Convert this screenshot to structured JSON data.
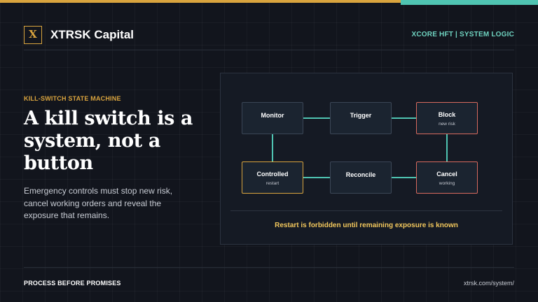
{
  "brand": {
    "logo_letter": "X",
    "name": "XTRSK Capital",
    "tagline": "XCORE HFT | SYSTEM LOGIC"
  },
  "slide": {
    "eyebrow": "KILL-SWITCH STATE MACHINE",
    "headline": "A kill switch is a system, not a button",
    "body": "Emergency controls must stop new risk, cancel working orders and reveal the exposure that remains."
  },
  "diagram": {
    "nodes": {
      "monitor": {
        "label": "Monitor",
        "sub": ""
      },
      "trigger": {
        "label": "Trigger",
        "sub": ""
      },
      "block": {
        "label": "Block",
        "sub": "new risk"
      },
      "controlled": {
        "label": "Controlled",
        "sub": "restart"
      },
      "reconcile": {
        "label": "Reconcile",
        "sub": ""
      },
      "cancel": {
        "label": "Cancel",
        "sub": "working"
      }
    },
    "caption": "Restart is forbidden until remaining exposure is known"
  },
  "footer": {
    "left": "PROCESS BEFORE PROMISES",
    "right": "xtrsk.com/system/"
  },
  "colors": {
    "background": "#12151d",
    "accent_gold": "#d9a43e",
    "accent_teal": "#4fc4b2",
    "alert_red": "#d86a5e",
    "caption_yellow": "#f2c75c"
  }
}
